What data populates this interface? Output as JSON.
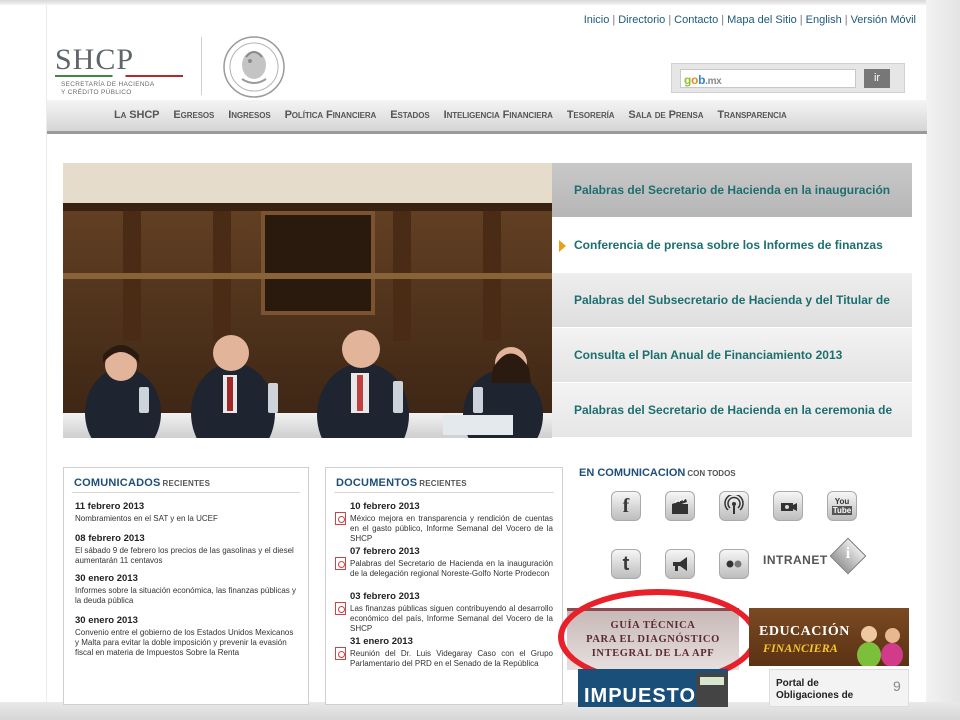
{
  "utility_nav": [
    "Inicio",
    "Directorio",
    "Contacto",
    "Mapa del Sitio",
    "English",
    "Versión Móvil"
  ],
  "logo": {
    "name": "SHCP",
    "subtitle_1": "SECRETARÍA DE HACIENDA",
    "subtitle_2": "Y CRÉDITO PÚBLICO"
  },
  "search": {
    "placeholder": "",
    "brand": {
      "g": "g",
      "o": "o",
      "b": "b",
      "mx": ".mx"
    },
    "button": "ir"
  },
  "main_nav": [
    "La SHCP",
    "Egresos",
    "Ingresos",
    "Política Financiera",
    "Estados",
    "Inteligencia Financiera",
    "Tesorería",
    "Sala de Prensa",
    "Transparencia"
  ],
  "headlines": [
    "Palabras del Secretario de Hacienda en la inauguración",
    "Conferencia de prensa sobre los Informes de finanzas",
    "Palabras del Subsecretario de Hacienda y del Titular de",
    "Consulta el Plan Anual de Financiamiento 2013",
    "Palabras del Secretario de Hacienda en la ceremonia de"
  ],
  "comunicados": {
    "title": "COMUNICADOS",
    "subtitle": "RECIENTES",
    "items": [
      {
        "date": "11 febrero 2013",
        "text": "Nombramientos en el SAT y en la UCEF"
      },
      {
        "date": "08 febrero 2013",
        "text": "El sábado 9 de febrero los precios de las gasolinas y el diesel aumentarán 11 centavos"
      },
      {
        "date": "30 enero 2013",
        "text": "Informes sobre la situación económica, las finanzas públicas y la deuda pública"
      },
      {
        "date": "30 enero 2013",
        "text": "Convenio entre el gobierno de los Estados Unidos Mexicanos y Malta para evitar la doble imposición y prevenir la evasión fiscal en materia de Impuestos Sobre la Renta"
      }
    ]
  },
  "documentos": {
    "title": "DOCUMENTOS",
    "subtitle": "RECIENTES",
    "items": [
      {
        "date": "10 febrero 2013",
        "text": "México mejora en transparencia y rendición de cuentas en el gasto público, Informe Semanal del Vocero de la SHCP"
      },
      {
        "date": "07 febrero 2013",
        "text": "Palabras del Secretario de Hacienda en la inauguración de la delegación regional Noreste-Golfo Norte Prodecon"
      },
      {
        "date": "03 febrero 2013",
        "text": "Las finanzas públicas siguen contribuyendo al desarrollo económico del país, Informe Semanal del Vocero de la SHCP"
      },
      {
        "date": "31 enero 2013",
        "text": "Reunión del Dr. Luis Videgaray Caso con el Grupo Parlamentario del PRD en el Senado de la República"
      }
    ]
  },
  "social": {
    "title": "EN COMUNICACION",
    "subtitle": "CON TODOS",
    "icons": [
      "facebook-icon",
      "video-clapper-icon",
      "podcast-icon",
      "webcam-icon",
      "youtube-icon",
      "twitter-icon",
      "megaphone-icon",
      "flickr-icon"
    ],
    "intranet": "INTRANET",
    "youtube_you": "You",
    "youtube_tube": "Tube",
    "facebook_glyph": "f",
    "twitter_glyph": "t"
  },
  "banners": {
    "guia_1": "GUÍA TÉCNICA",
    "guia_2": "PARA EL DIAGNÓSTICO",
    "guia_3": "INTEGRAL DE LA APF",
    "educacion_1": "EDUCACIÓN",
    "educacion_2": "FINANCIERA",
    "impuestos": "IMPUESTOS",
    "portal_1": "Portal de",
    "portal_2": "Obligaciones de"
  },
  "page_number": "9",
  "colors": {
    "headline_text": "#1d6f6f",
    "section_title": "#1f4e79",
    "highlight_ring": "#e8202a",
    "headline_marker": "#e8a21a"
  }
}
